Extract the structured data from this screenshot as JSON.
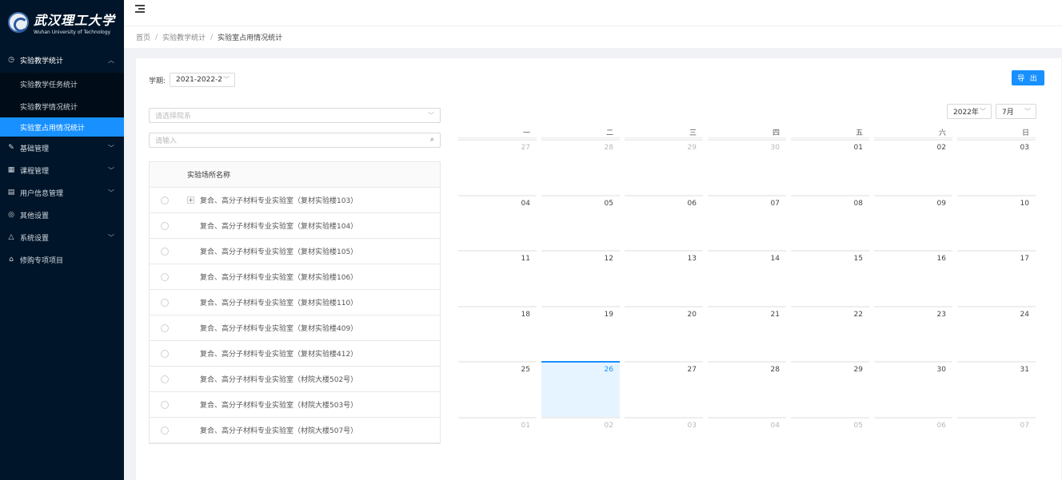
{
  "logo": {
    "cn": "武汉理工大学",
    "en": "Wuhan University of Technology"
  },
  "sidebar": {
    "open_group": {
      "label": "实验教学统计",
      "icon": "clock-icon"
    },
    "sub_items": [
      "实验教学任务统计",
      "实验教学情况统计",
      "实验室占用情况统计"
    ],
    "active_sub_index": 2,
    "items": [
      {
        "label": "基础管理",
        "icon": "edit-icon",
        "arrow": true
      },
      {
        "label": "课程管理",
        "icon": "grid-icon",
        "arrow": true
      },
      {
        "label": "用户信息管理",
        "icon": "user-card-icon",
        "arrow": true
      },
      {
        "label": "其他设置",
        "icon": "check-circle-icon",
        "arrow": false
      },
      {
        "label": "系统设置",
        "icon": "warning-icon",
        "arrow": true
      },
      {
        "label": "修购专项项目",
        "icon": "bank-icon",
        "arrow": false
      }
    ]
  },
  "breadcrumb": [
    "首页",
    "实验教学统计",
    "实验室占用情况统计"
  ],
  "filters": {
    "term_label": "学期:",
    "term_value": "2021-2022-2",
    "export_label": "导 出",
    "dept_placeholder": "请选择院系",
    "search_placeholder": "请输入"
  },
  "table": {
    "header": "实验场所名称",
    "rows": [
      {
        "name": "复合、高分子材料专业实验室（复材实验楼103）",
        "expandable": true
      },
      {
        "name": "复合、高分子材料专业实验室（复材实验楼104）",
        "expandable": false
      },
      {
        "name": "复合、高分子材料专业实验室（复材实验楼105）",
        "expandable": false
      },
      {
        "name": "复合、高分子材料专业实验室（复材实验楼106）",
        "expandable": false
      },
      {
        "name": "复合、高分子材料专业实验室（复材实验楼110）",
        "expandable": false
      },
      {
        "name": "复合、高分子材料专业实验室（复材实验楼409）",
        "expandable": false
      },
      {
        "name": "复合、高分子材料专业实验室（复材实验楼412）",
        "expandable": false
      },
      {
        "name": "复合、高分子材料专业实验室（材院大楼502号）",
        "expandable": false
      },
      {
        "name": "复合、高分子材料专业实验室（材院大楼503号）",
        "expandable": false
      },
      {
        "name": "复合、高分子材料专业实验室（材院大楼507号）",
        "expandable": false
      }
    ]
  },
  "calendar": {
    "year": "2022年",
    "month": "7月",
    "weekdays": [
      "一",
      "二",
      "三",
      "四",
      "五",
      "六",
      "日"
    ],
    "days": [
      {
        "d": "27",
        "muted": true
      },
      {
        "d": "28",
        "muted": true
      },
      {
        "d": "29",
        "muted": true
      },
      {
        "d": "30",
        "muted": true
      },
      {
        "d": "01"
      },
      {
        "d": "02"
      },
      {
        "d": "03"
      },
      {
        "d": "04"
      },
      {
        "d": "05"
      },
      {
        "d": "06"
      },
      {
        "d": "07"
      },
      {
        "d": "08"
      },
      {
        "d": "09"
      },
      {
        "d": "10"
      },
      {
        "d": "11"
      },
      {
        "d": "12"
      },
      {
        "d": "13"
      },
      {
        "d": "14"
      },
      {
        "d": "15"
      },
      {
        "d": "16"
      },
      {
        "d": "17"
      },
      {
        "d": "18"
      },
      {
        "d": "19"
      },
      {
        "d": "20"
      },
      {
        "d": "21"
      },
      {
        "d": "22"
      },
      {
        "d": "23"
      },
      {
        "d": "24"
      },
      {
        "d": "25"
      },
      {
        "d": "26",
        "today": true
      },
      {
        "d": "27"
      },
      {
        "d": "28"
      },
      {
        "d": "29"
      },
      {
        "d": "30"
      },
      {
        "d": "31"
      },
      {
        "d": "01",
        "muted": true
      },
      {
        "d": "02",
        "muted": true
      },
      {
        "d": "03",
        "muted": true
      },
      {
        "d": "04",
        "muted": true
      },
      {
        "d": "05",
        "muted": true
      },
      {
        "d": "06",
        "muted": true
      },
      {
        "d": "07",
        "muted": true
      }
    ]
  },
  "colors": {
    "sidebar_bg": "#001529",
    "accent": "#1890ff",
    "today_bg": "#e6f4ff"
  }
}
